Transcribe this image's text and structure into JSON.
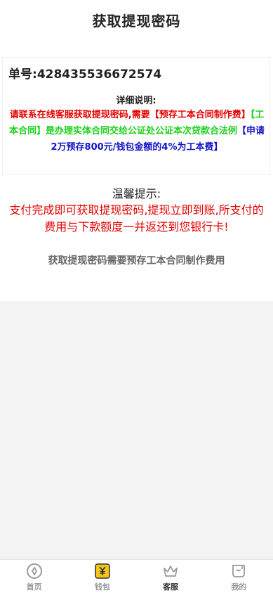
{
  "header": {
    "title": "获取提现密码"
  },
  "order": {
    "label": "单号:",
    "number": "428435536672574"
  },
  "detail": {
    "title": "详细说明:",
    "line_red": "请联系在线客服获取提现密码,需要【预存工本合同制作费】",
    "line_green": "【工本合同】是办理实体合同交给公证处公证本次贷款合法例",
    "line_blue": "【申请2万预存800元/钱包金额的4%为工本费】"
  },
  "tips": {
    "title": "温馨提示:",
    "body": "支付完成即可获取提现密码,提现立即到账,所支付的费用与下款额度一并返还到您银行卡!"
  },
  "fee_note": "获取提现密码需要预存工本合同制作费用",
  "tabbar": {
    "items": [
      {
        "label": "首页",
        "icon": "home-icon"
      },
      {
        "label": "钱包",
        "icon": "wallet-yen-icon"
      },
      {
        "label": "客服",
        "icon": "crown-icon"
      },
      {
        "label": "我的",
        "icon": "profile-pocket-icon"
      }
    ],
    "active_index": 2
  },
  "colors": {
    "red": "#e60000",
    "green": "#1bd11b",
    "blue": "#1414c8",
    "wallet_accent": "#f5c518"
  }
}
